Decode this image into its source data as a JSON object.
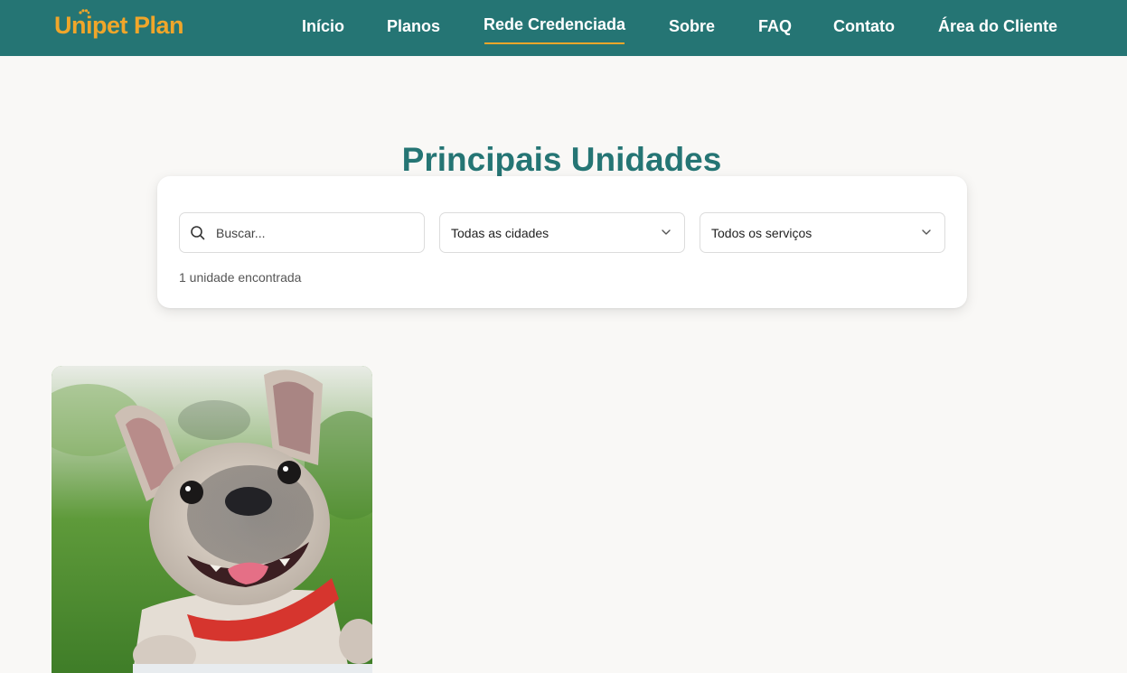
{
  "header": {
    "brand": "Unipet Plan",
    "brand_color": "#f0a62a",
    "background": "#257574",
    "nav": [
      {
        "label": "Início",
        "active": false
      },
      {
        "label": "Planos",
        "active": false
      },
      {
        "label": "Rede Credenciada",
        "active": true
      },
      {
        "label": "Sobre",
        "active": false
      },
      {
        "label": "FAQ",
        "active": false
      },
      {
        "label": "Contato",
        "active": false
      },
      {
        "label": "Área do Cliente",
        "active": false
      }
    ]
  },
  "main": {
    "title": "Principais Unidades",
    "title_color": "#257574",
    "filters": {
      "search_placeholder": "Buscar...",
      "search_icon": "search-icon",
      "city_value": "Todas as cidades",
      "service_value": "Todos os serviços",
      "chevron_icon": "chevron-down-icon"
    },
    "result_count": "1 unidade encontrada"
  }
}
